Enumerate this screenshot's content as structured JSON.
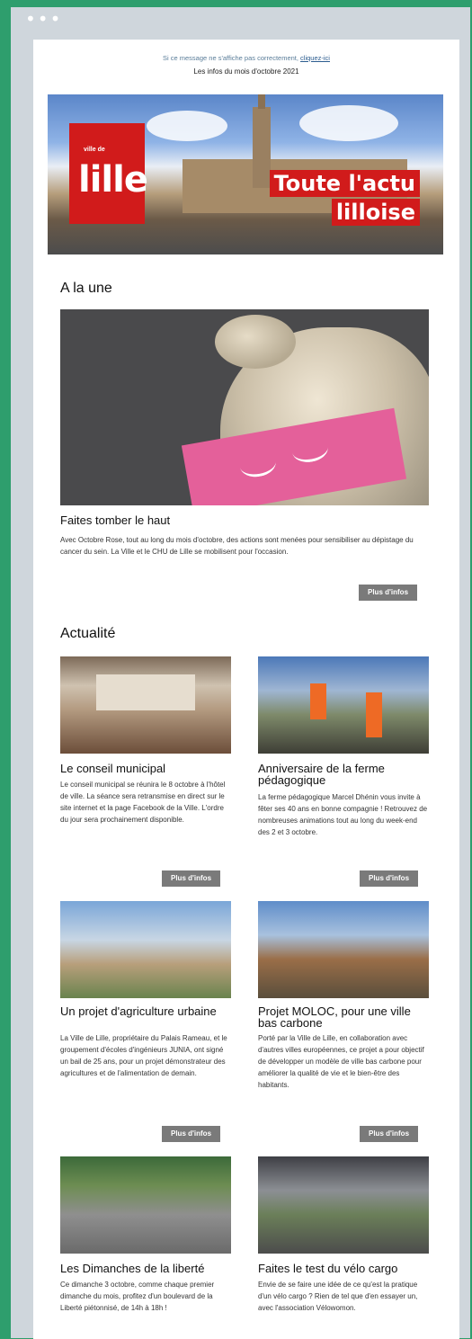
{
  "window": {
    "dots": "•••"
  },
  "email": {
    "preheader_text": "Si ce message ne s'affiche pas correctement,",
    "preheader_link": "cliquez-ici",
    "month_line": "Les infos du mois d'octobre 2021",
    "banner": {
      "logo_small": "ville de",
      "logo_big": "lille",
      "tag_line1": "Toute l'actu",
      "tag_line2": "lilloise"
    },
    "a_la_une": {
      "section_title": "A la une",
      "article_title": "Faites tomber le haut",
      "article_body": "Avec Octobre Rose, tout au long du mois d'octobre, des actions sont menées pour sensibiliser au dépistage du cancer du sein. La Ville et le CHU de Lille se mobilisent pour l'occasion.",
      "button": "Plus d'infos"
    },
    "actualite": {
      "section_title": "Actualité",
      "articles": [
        {
          "title": "Le conseil municipal",
          "body": "Le conseil municipal se réunira le 8 octobre à l'hôtel de ville. La séance sera retransmise en direct sur le site internet et la page Facebook de la Ville. L'ordre du jour sera prochainement disponible.",
          "button": "Plus d'infos"
        },
        {
          "title": "Anniversaire de la ferme pédagogique",
          "body": "La ferme pédagogique Marcel Dhénin vous invite à fêter ses 40 ans en bonne compagnie ! Retrouvez de nombreuses animations tout au long du week-end des 2 et 3 octobre.",
          "button": "Plus d'infos"
        },
        {
          "title": "Un projet d'agriculture urbaine",
          "body": "La Ville de Lille, propriétaire du Palais Rameau, et le groupement d'écoles d'ingénieurs JUNIA, ont signé un bail de 25 ans, pour un projet démonstrateur des agricultures et de l'alimentation de demain.",
          "button": "Plus d'infos"
        },
        {
          "title": "Projet MOLOC, pour une ville bas carbone",
          "body": "Porté par la Ville de Lille, en collaboration avec d'autres villes européennes, ce projet a pour objectif de développer un modèle de ville bas carbone pour améliorer la qualité de vie et le bien-être des habitants.",
          "button": "Plus d'infos"
        },
        {
          "title": "Les Dimanches de la liberté",
          "body": "Ce dimanche 3 octobre, comme chaque premier dimanche du mois, profitez d'un boulevard de la Liberté piétonnisé, de 14h à 18h !",
          "button": ""
        },
        {
          "title": "Faites le test du vélo cargo",
          "body": "Envie de se faire une idée de ce qu'est la pratique d'un vélo cargo ? Rien de tel que d'en essayer un, avec l'association Vélowomon.",
          "button": ""
        }
      ]
    }
  },
  "colors": {
    "page_bg": "#2e9e6d",
    "frame_bg": "#cfd6dc",
    "brand_red": "#d11b1b",
    "pink": "#e4609a",
    "button_bg": "#7a7a7a"
  }
}
